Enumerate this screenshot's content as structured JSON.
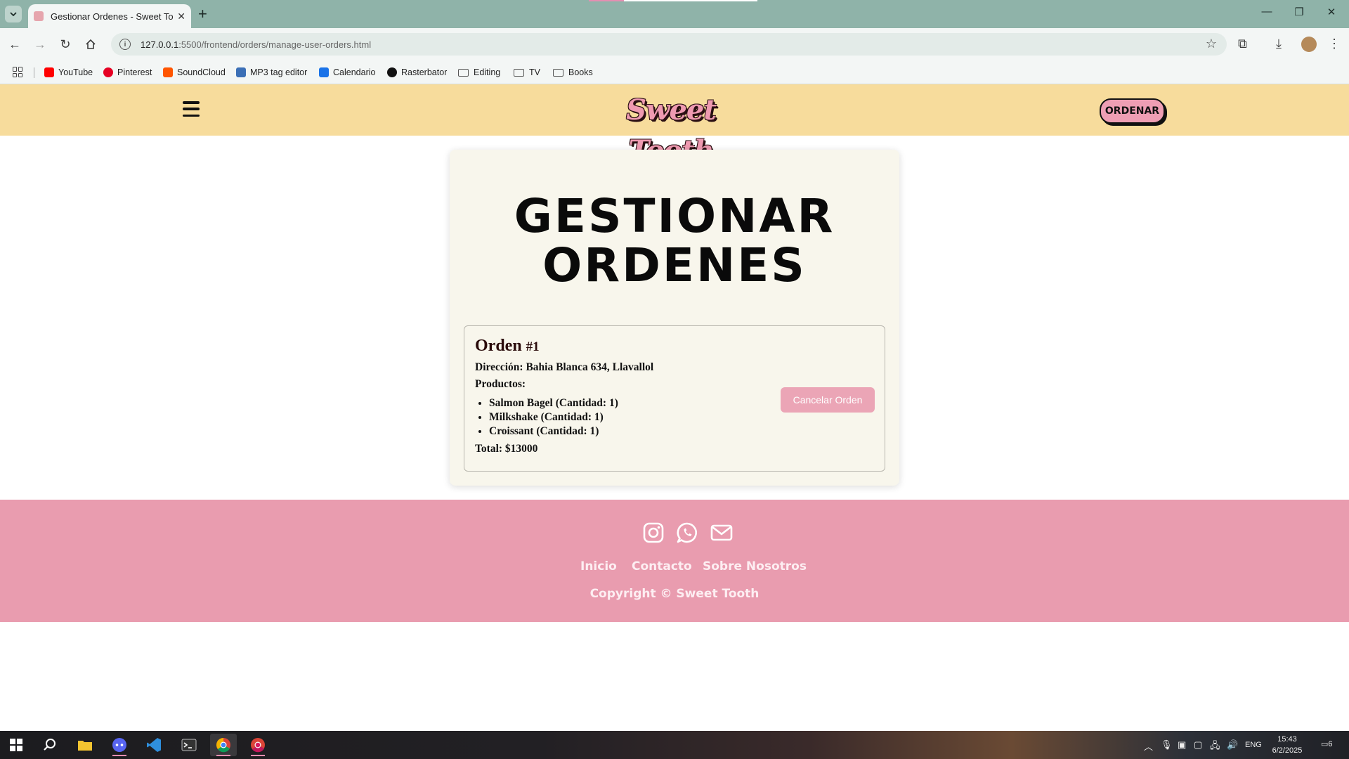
{
  "browser": {
    "tab_title": "Gestionar Ordenes - Sweet Tooth",
    "new_tab": "+",
    "url_host": "127.0.0.1",
    "url_rest": ":5500/frontend/orders/manage-user-orders.html",
    "bookmarks": [
      {
        "label": "YouTube",
        "icon": "youtube-icon",
        "color": "#ff0000"
      },
      {
        "label": "Pinterest",
        "icon": "pinterest-icon",
        "color": "#e60023"
      },
      {
        "label": "SoundCloud",
        "icon": "soundcloud-icon",
        "color": "#ff5500"
      },
      {
        "label": "MP3 tag editor",
        "icon": "tag-icon",
        "color": "#3b6fb6"
      },
      {
        "label": "Calendario",
        "icon": "calendar-icon",
        "color": "#1a73e8"
      },
      {
        "label": "Rasterbator",
        "icon": "rasterbator-icon",
        "color": "#111111"
      },
      {
        "label": "Editing",
        "icon": "folder-icon"
      },
      {
        "label": "TV",
        "icon": "folder-icon"
      },
      {
        "label": "Books",
        "icon": "folder-icon"
      }
    ]
  },
  "header": {
    "logo_text": "Sweet Tooth",
    "order_button": "ORDENAR"
  },
  "main": {
    "title_line1": "GESTIONAR",
    "title_line2": "ORDENES",
    "order": {
      "title": "Orden",
      "number": "#1",
      "address_label": "Dirección:",
      "address": "Bahia Blanca 634, Llavallol",
      "products_label": "Productos:",
      "products": [
        "Salmon Bagel (Cantidad: 1)",
        "Milkshake (Cantidad: 1)",
        "Croissant (Cantidad: 1)"
      ],
      "total_label": "Total:",
      "total": "$13000",
      "cancel_button": "Cancelar Orden"
    }
  },
  "footer": {
    "links": [
      "Inicio",
      "Contacto",
      "Sobre Nosotros"
    ],
    "copyright": "Copyright © Sweet Tooth",
    "social_icons": [
      "instagram-icon",
      "whatsapp-icon",
      "email-icon"
    ]
  },
  "taskbar": {
    "language": "ENG",
    "time": "15:43",
    "date": "6/2/2025",
    "notifications": "6"
  },
  "colors": {
    "header_bg": "#f7dc9c",
    "footer_bg": "#e99caf",
    "accent_pink": "#ee9eb4",
    "card_bg": "#f8f6ec"
  }
}
